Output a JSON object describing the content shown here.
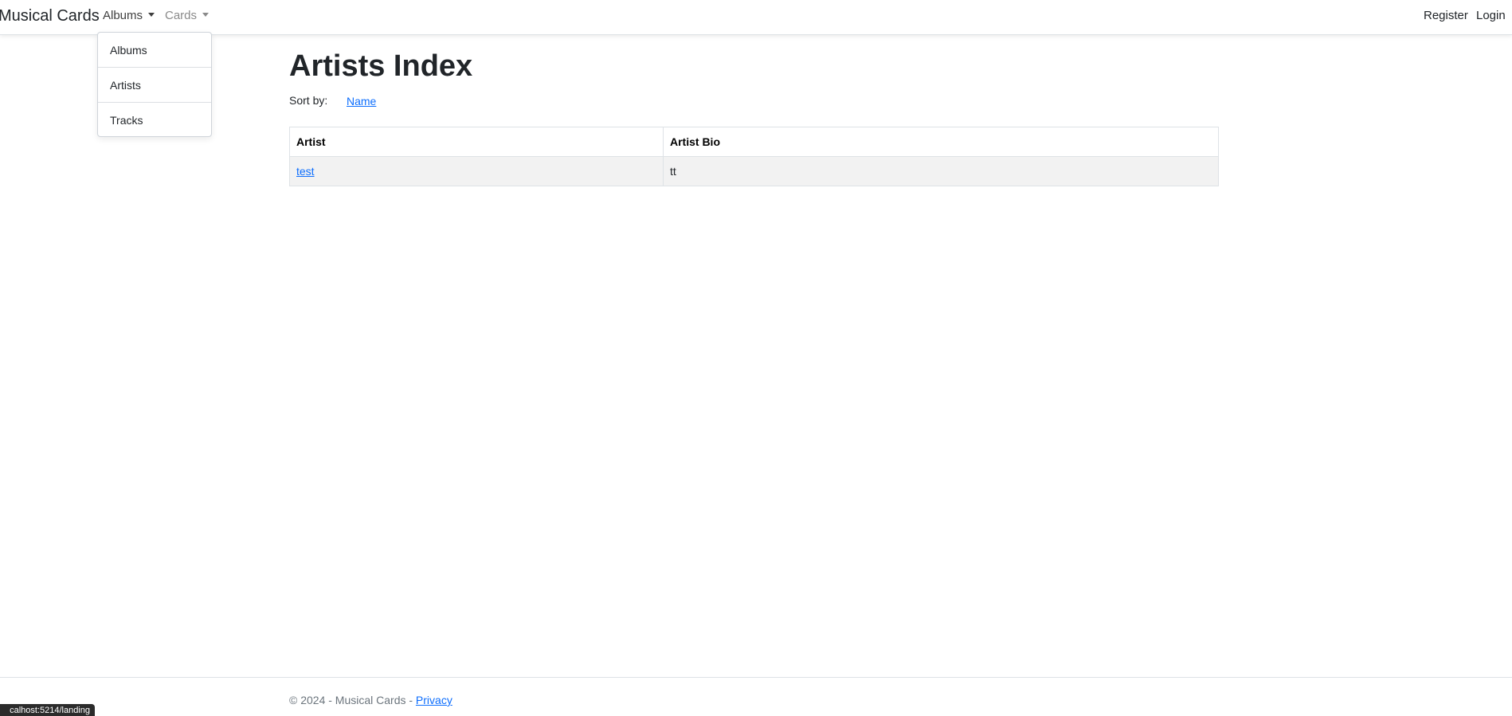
{
  "navbar": {
    "brand": "Musical Cards",
    "menus": [
      {
        "label": "Albums"
      },
      {
        "label": "Cards"
      }
    ],
    "right_links": [
      "Register",
      "Login"
    ]
  },
  "dropdown": {
    "items": [
      "Albums",
      "Artists",
      "Tracks"
    ]
  },
  "main": {
    "title": "Artists Index",
    "sort_label": "Sort by:",
    "sort_link": "Name",
    "table": {
      "columns": [
        "Artist",
        "Artist Bio"
      ],
      "rows": [
        {
          "artist": "test",
          "bio": "tt"
        }
      ]
    }
  },
  "footer": {
    "text": "© 2024 - Musical Cards - ",
    "privacy": "Privacy"
  },
  "status_bar": {
    "url": "calhost:5214/landing"
  }
}
